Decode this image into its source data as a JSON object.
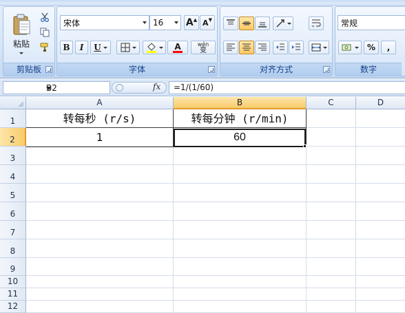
{
  "ribbon": {
    "clipboard": {
      "group_label": "剪贴板",
      "paste_label": "粘贴",
      "paste_icon": "paste-icon",
      "cut_icon": "scissors-icon",
      "copy_icon": "copy-icon",
      "format_painter_icon": "format-painter-icon"
    },
    "font": {
      "group_label": "字体",
      "font_name": "宋体",
      "font_size": "16",
      "grow_label": "A",
      "shrink_label": "A",
      "bold_label": "B",
      "italic_label": "I",
      "underline_label": "U",
      "font_color_label": "A",
      "phonetic_label": "wén",
      "phonetic_char": "变",
      "fill_color": "#ffff00",
      "font_color": "#ff0000"
    },
    "alignment": {
      "group_label": "对齐方式"
    },
    "number": {
      "group_label": "数字",
      "format_value": "常规",
      "percent_label": "%",
      "comma_label": ","
    }
  },
  "formula_bar": {
    "name_box": "B2",
    "fx_label": "fx",
    "formula": "=1/(1/60)"
  },
  "sheet": {
    "columns": [
      "A",
      "B",
      "C",
      "D"
    ],
    "selected_column": "B",
    "rows": [
      "1",
      "2",
      "3",
      "4",
      "5",
      "6",
      "7",
      "8",
      "9",
      "10",
      "11",
      "12"
    ],
    "selected_row": "2",
    "cells": {
      "A1": "转每秒 (r/s)",
      "B1": "转每分钟 (r/min)",
      "A2": "1",
      "B2": "60"
    },
    "active_cell": "B2"
  },
  "colors": {
    "selection_header": "#f8cb6b",
    "ribbon_label": "#15428b",
    "grid_line": "#d4dce8"
  }
}
